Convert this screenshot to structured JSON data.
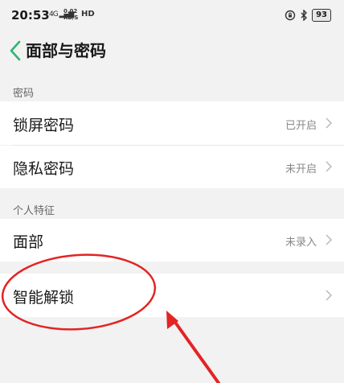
{
  "status_bar": {
    "time": "20:53",
    "signal": "4G",
    "speed_value": "0.02",
    "speed_unit": "KB/S",
    "hd": "HD",
    "battery": "93"
  },
  "header": {
    "title": "面部与密码"
  },
  "sections": {
    "password": {
      "label": "密码",
      "items": [
        {
          "label": "锁屏密码",
          "status": "已开启"
        },
        {
          "label": "隐私密码",
          "status": "未开启"
        }
      ]
    },
    "personal": {
      "label": "个人特征",
      "items": [
        {
          "label": "面部",
          "status": "未录入"
        }
      ]
    },
    "unlock": {
      "items": [
        {
          "label": "智能解锁"
        }
      ]
    }
  },
  "colors": {
    "accent": "#2bb673",
    "annotation": "#e32424"
  }
}
